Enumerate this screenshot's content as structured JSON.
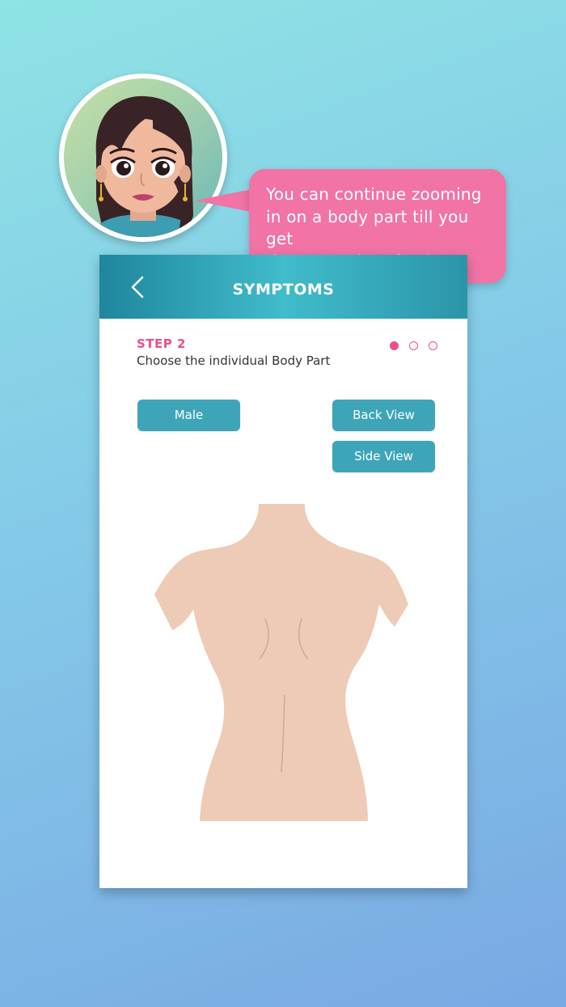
{
  "assistant": {
    "message": "You can continue zooming\nin on a body part till you get\nthe exact site of pain\nor discomfort."
  },
  "header": {
    "title": "SYMPTOMS"
  },
  "step": {
    "label": "STEP 2",
    "description": "Choose the individual Body Part",
    "total_steps": 3,
    "current_step": 1
  },
  "buttons": {
    "gender": "Male",
    "back_view": "Back View",
    "side_view": "Side View"
  },
  "icons": {
    "back": "chevron-left-icon",
    "avatar": "female-assistant-avatar"
  },
  "colors": {
    "accent_pink": "#ec4f8e",
    "bubble_pink": "#f273a6",
    "teal": "#3ea5b9",
    "skin": "#eecbb7"
  }
}
